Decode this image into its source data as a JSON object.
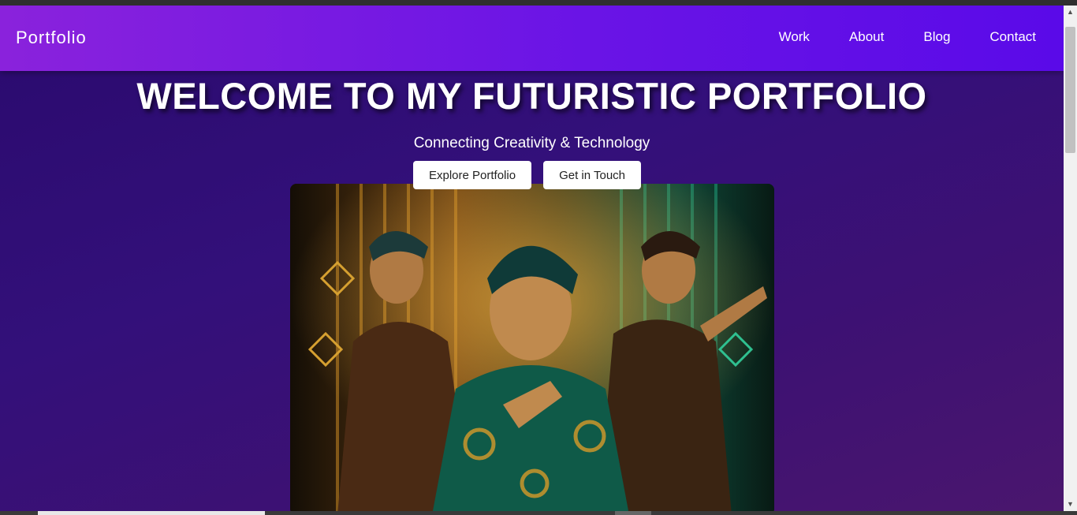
{
  "nav": {
    "brand": "Portfolio",
    "links": [
      "Work",
      "About",
      "Blog",
      "Contact"
    ]
  },
  "hero": {
    "title": "WELCOME TO MY FUTURISTIC PORTFOLIO",
    "subtitle": "Connecting Creativity & Technology",
    "primary_button": "Explore Portfolio",
    "secondary_button": "Get in Touch"
  },
  "colors": {
    "navbar_start": "#8a22dc",
    "navbar_end": "#5a0ae8",
    "background": "#2a0a6e"
  },
  "scrollbar": {
    "up_icon": "▲",
    "down_icon": "▼"
  }
}
